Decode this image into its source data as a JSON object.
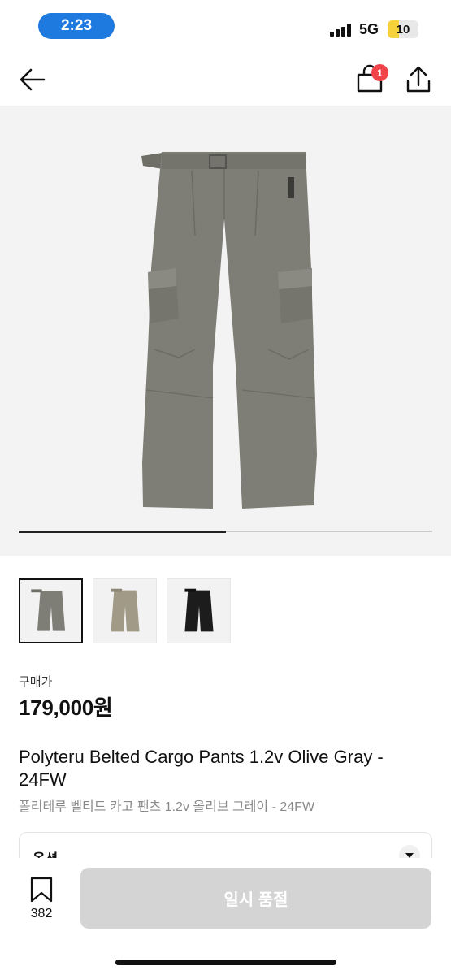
{
  "status_bar": {
    "time": "2:23",
    "network": "5G",
    "battery_level": "10"
  },
  "nav": {
    "cart_count": "1",
    "icons": [
      "back-arrow-icon",
      "shopping-bag-icon",
      "share-icon"
    ]
  },
  "gallery": {
    "progress": 0.5,
    "thumbnails": [
      "olive-gray-pants",
      "beige-pants",
      "black-pants"
    ],
    "colors": {
      "olive_gray": "#7e7e76",
      "beige": "#a09a86",
      "black": "#1c1c1c"
    }
  },
  "price": {
    "label": "구매가",
    "value": "179,000원"
  },
  "product": {
    "name_en": "Polyteru Belted Cargo Pants 1.2v Olive Gray - 24FW",
    "name_ko": "폴리테루 벨티드 카고 팬츠 1.2v 올리브 그레이 - 24FW"
  },
  "options": {
    "label": "옵션"
  },
  "bottom": {
    "wishlist_count": "382",
    "soldout_label": "일시 품절"
  },
  "colors": {
    "accent_blue": "#1f7ae0",
    "badge_red": "#f0444a",
    "disabled_button": "#d4d4d4"
  }
}
